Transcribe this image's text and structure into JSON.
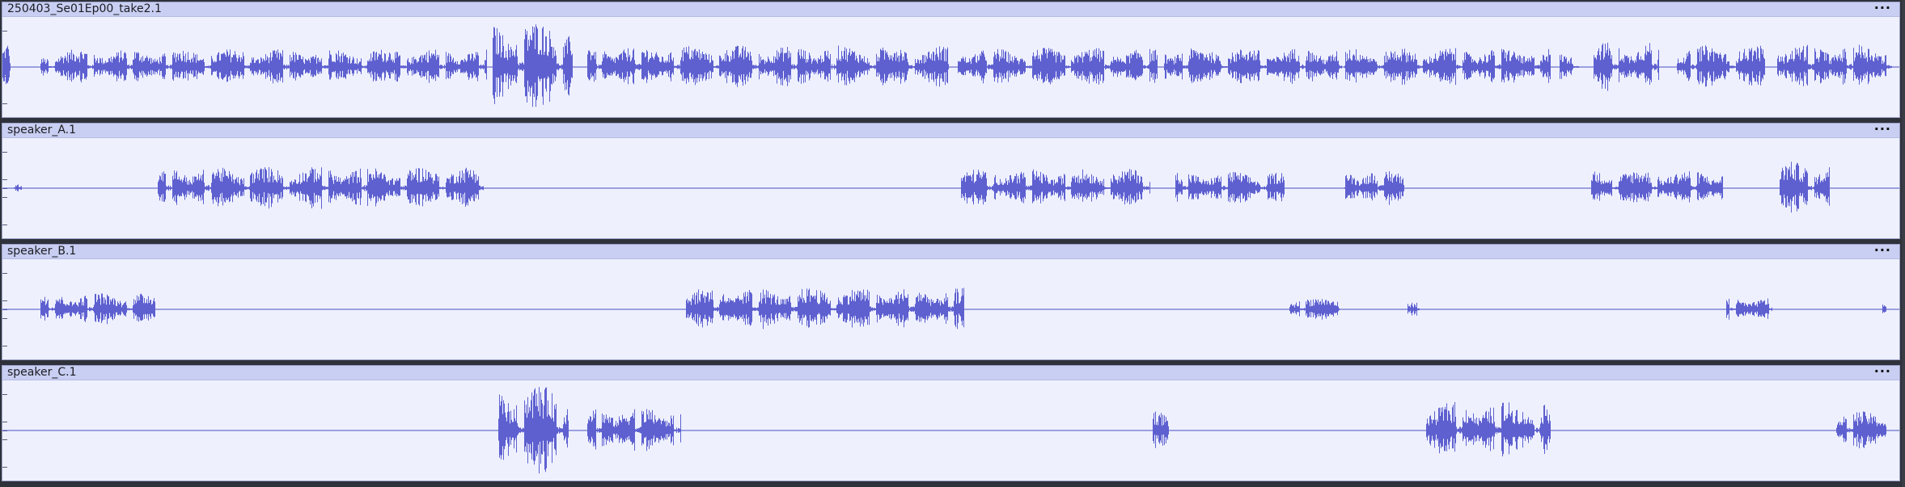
{
  "colors": {
    "waveform": "#5e60d0",
    "centerline": "#4a4ec4",
    "clip_background": "#eef1fd",
    "clip_header": "#c9cff2"
  },
  "menu_icon": "ellipsis-icon",
  "tracks": [
    {
      "name": "250403_Se01Ep00_take2.1",
      "menu_label": "···",
      "segments": [
        [
          0.0,
          0.004,
          0.85
        ],
        [
          0.02,
          0.026,
          0.25
        ],
        [
          0.027,
          0.255,
          0.38
        ],
        [
          0.258,
          0.3,
          0.95
        ],
        [
          0.308,
          0.498,
          0.45
        ],
        [
          0.503,
          0.608,
          0.4
        ],
        [
          0.612,
          0.705,
          0.4
        ],
        [
          0.707,
          0.815,
          0.4
        ],
        [
          0.82,
          0.83,
          0.3
        ],
        [
          0.838,
          0.872,
          0.52
        ],
        [
          0.882,
          0.928,
          0.45
        ],
        [
          0.935,
          0.995,
          0.48
        ]
      ]
    },
    {
      "name": "speaker_A.1",
      "menu_label": "···",
      "segments": [
        [
          0.006,
          0.01,
          0.08
        ],
        [
          0.082,
          0.253,
          0.45
        ],
        [
          0.505,
          0.604,
          0.4
        ],
        [
          0.618,
          0.675,
          0.35
        ],
        [
          0.707,
          0.738,
          0.4
        ],
        [
          0.837,
          0.906,
          0.38
        ],
        [
          0.936,
          0.962,
          0.55
        ]
      ]
    },
    {
      "name": "speaker_B.1",
      "menu_label": "···",
      "segments": [
        [
          0.02,
          0.08,
          0.35
        ],
        [
          0.36,
          0.506,
          0.45
        ],
        [
          0.678,
          0.704,
          0.25
        ],
        [
          0.74,
          0.746,
          0.15
        ],
        [
          0.908,
          0.932,
          0.25
        ],
        [
          0.99,
          0.992,
          0.12
        ]
      ]
    },
    {
      "name": "speaker_C.1",
      "menu_label": "···",
      "segments": [
        [
          0.261,
          0.298,
          0.95
        ],
        [
          0.308,
          0.357,
          0.5
        ],
        [
          0.606,
          0.614,
          0.45
        ],
        [
          0.75,
          0.815,
          0.6
        ],
        [
          0.966,
          0.992,
          0.4
        ]
      ]
    }
  ]
}
